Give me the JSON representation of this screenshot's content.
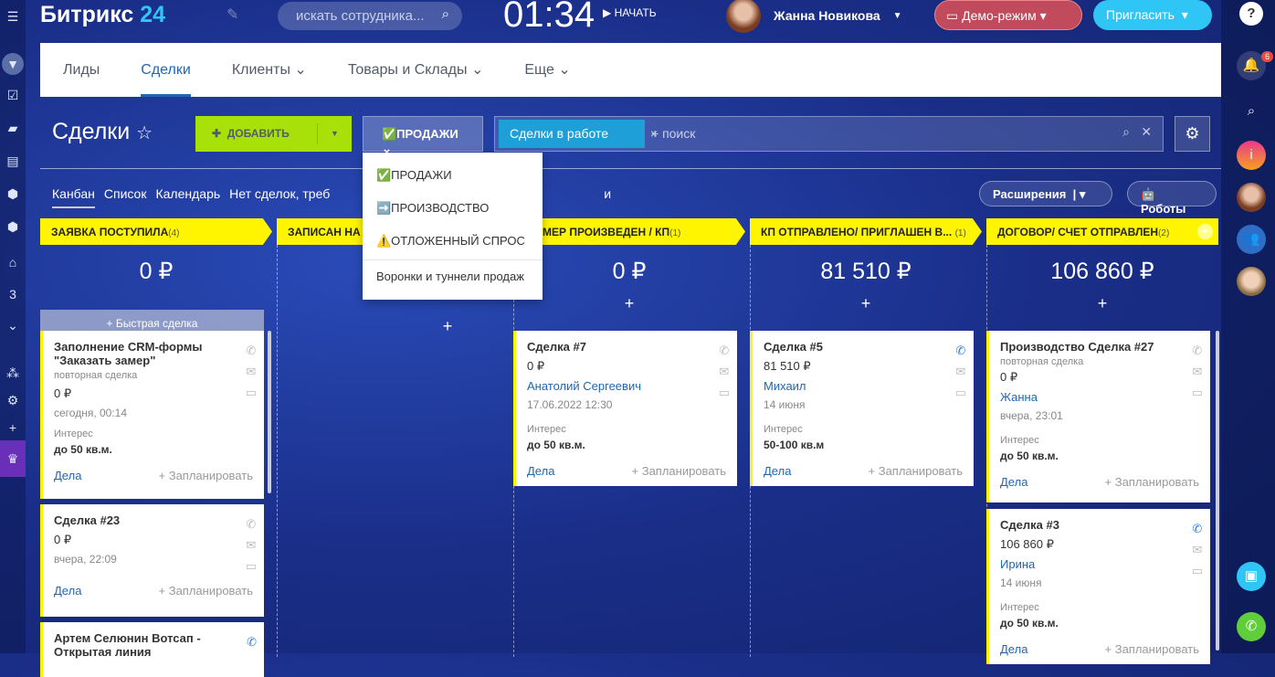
{
  "header": {
    "logo": "Битрикс",
    "logo_num": "24",
    "search_placeholder": "искать сотрудника...",
    "clock": "01:34",
    "start": "НАЧАТЬ",
    "user": "Жанна Новикова",
    "demo": "Демо-режим",
    "invite": "Пригласить",
    "notifications": "6"
  },
  "leftrail": {
    "counter": "3"
  },
  "nav": [
    "Лиды",
    "Сделки",
    "Клиенты",
    "Товары и Склады",
    "Еще"
  ],
  "toolbar": {
    "title": "Сделки",
    "add": "ДОБАВИТЬ",
    "category": "✅ПРОДАЖИ",
    "filter_chip": "Сделки в работе",
    "filter_placeholder": "+ поиск"
  },
  "dropdown": [
    "✅ПРОДАЖИ",
    "➡️ПРОИЗВОДСТВО",
    "⚠️ОТЛОЖЕННЫЙ СПРОС",
    "Воронки и туннели продаж"
  ],
  "views": {
    "items": [
      "Канбан",
      "Список",
      "Календарь",
      "Нет сделок, треб",
      "и"
    ],
    "extensions": "Расширения",
    "robots": "Роботы"
  },
  "quick_deal": "+ Быстрая сделка",
  "columns": [
    {
      "title": "ЗАЯВКА ПОСТУПИЛА",
      "count": "(4)",
      "sum": "0 ₽"
    },
    {
      "title": "ЗАПИСАН НА",
      "count": "",
      "sum": ""
    },
    {
      "title": "МЕР ПРОИЗВЕДЕН / КП",
      "count": "(1)",
      "sum": "0 ₽"
    },
    {
      "title": "КП ОТПРАВЛЕНО/ ПРИГЛАШЕН В...",
      "count": "(1)",
      "sum": "81 510 ₽"
    },
    {
      "title": "ДОГОВОР/ СЧЕТ ОТПРАВЛЕН",
      "count": "(2)",
      "sum": "106 860 ₽"
    }
  ],
  "card_labels": {
    "interest": "Интерес",
    "deals": "Дела",
    "plan": "+ Запланировать",
    "repeat": "повторная сделка"
  },
  "cards": [
    {
      "name": "Заполнение CRM-формы \"Заказать замер\"",
      "amount": "0 ₽",
      "date": "сегодня, 00:14",
      "interest": "до 50 кв.м."
    },
    {
      "name": "Сделка #23",
      "amount": "0 ₽",
      "date": "вчера, 22:09"
    },
    {
      "name": "Артем Селюнин Вотсап - Открытая линия"
    },
    {
      "name": "Сделка #7",
      "amount": "0 ₽",
      "contact": "Анатолий Сергеевич",
      "date": "17.06.2022 12:30",
      "interest": "до 50 кв.м."
    },
    {
      "name": "Сделка #5",
      "amount": "81 510 ₽",
      "contact": "Михаил",
      "date": "14 июня",
      "interest": "50-100 кв.м"
    },
    {
      "name": "Производство Сделка #27",
      "amount": "0 ₽",
      "contact": "Жанна",
      "date": "вчера, 23:01",
      "interest": "до 50 кв.м."
    },
    {
      "name": "Сделка #3",
      "amount": "106 860 ₽",
      "contact": "Ирина",
      "date": "14 июня",
      "interest": "до 50 кв.м."
    }
  ]
}
